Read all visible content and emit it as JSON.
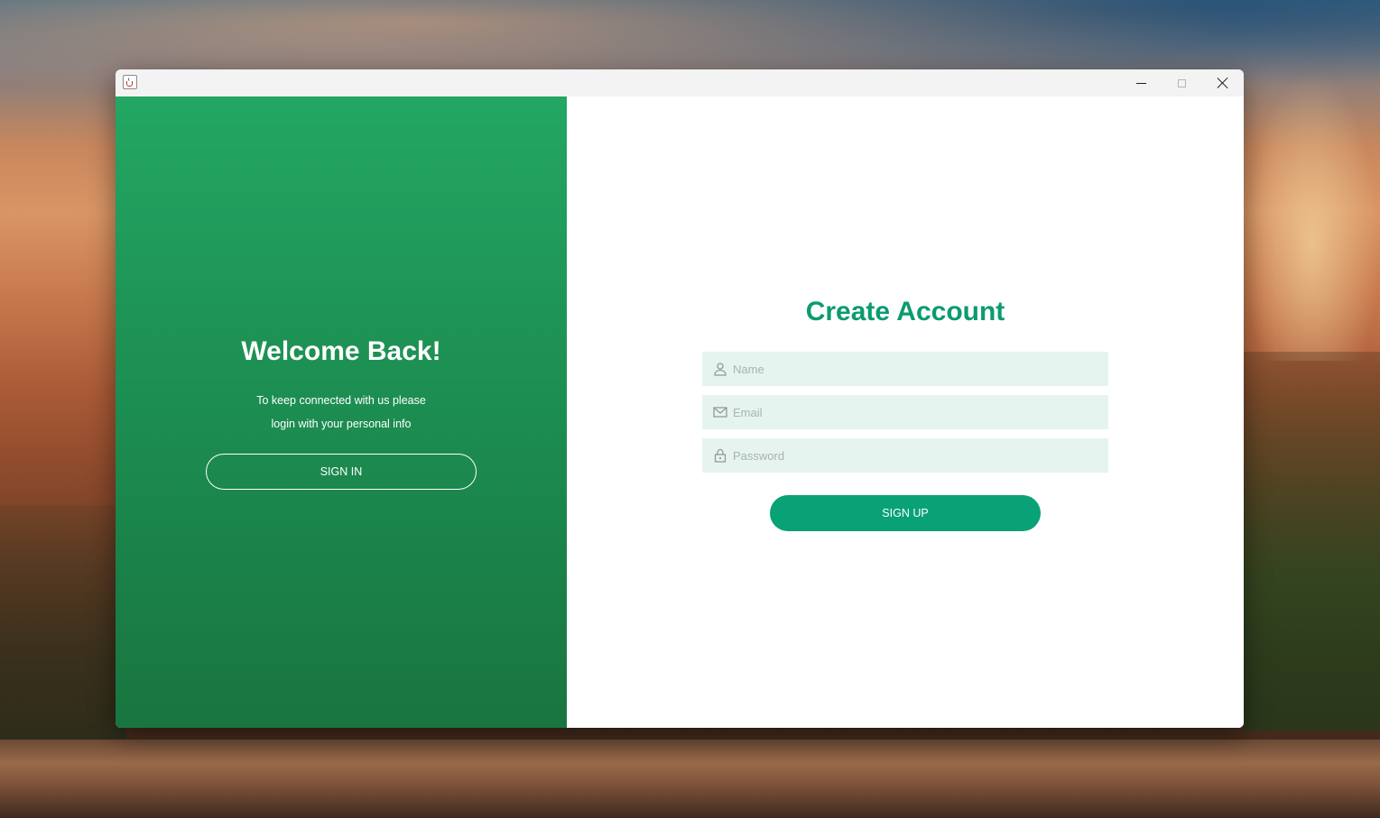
{
  "left_panel": {
    "title": "Welcome Back!",
    "subtitle_line1": "To keep connected with us please",
    "subtitle_line2": "login with your personal info",
    "button_label": "SIGN IN"
  },
  "right_panel": {
    "title": "Create Account",
    "fields": {
      "name": {
        "placeholder": "Name",
        "value": "",
        "icon": "user-icon"
      },
      "email": {
        "placeholder": "Email",
        "value": "",
        "icon": "mail-icon"
      },
      "password": {
        "placeholder": "Password",
        "value": "",
        "icon": "lock-icon"
      }
    },
    "button_label": "SIGN UP"
  },
  "colors": {
    "accent": "#09a176",
    "title_green": "#0b9b70",
    "panel_green_top": "#23a762",
    "panel_green_bottom": "#19753f",
    "field_bg": "#e6f4f0"
  }
}
